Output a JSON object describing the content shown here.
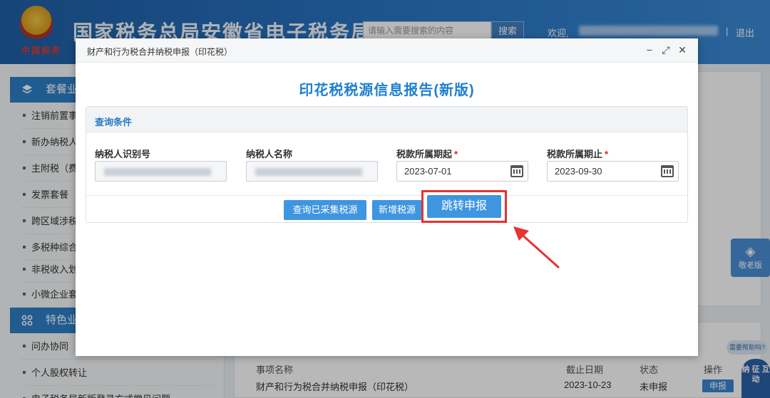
{
  "site": {
    "brand_tag": "中国税务",
    "title": "国家税务总局安徽省电子税务局",
    "search_placeholder": "请输入需要搜索的内容",
    "search_button": "搜索",
    "welcome": "欢迎,",
    "separator": "|",
    "logout": "退出"
  },
  "sidebar": {
    "sections": [
      {
        "label": "套餐业",
        "icon": "layers-icon"
      },
      {
        "label": "特色业",
        "icon": "grid-icon"
      }
    ],
    "items_a": [
      "注销前置事",
      "新办纳税人",
      "主附税（费",
      "发票套餐",
      "跨区域涉税",
      "多税种综合",
      "非税收入划",
      "小微企业套"
    ],
    "items_b": [
      "问办协同",
      "个人股权转让",
      "电子税务局新版登录方式常见问题"
    ]
  },
  "task_table": {
    "headers": [
      "事项名称",
      "截止日期",
      "状态",
      "操作"
    ],
    "row": {
      "name": "财产和行为税合并纳税申报（印花税）",
      "deadline": "2023-10-23",
      "status": "未申报",
      "action": "申报"
    }
  },
  "side_widgets": {
    "elder_mode": "敬老版",
    "help": "需要帮助吗?",
    "assistant": "纳 征 互 动"
  },
  "modal": {
    "title": "财产和行为税合并纳税申报（印花税）",
    "controls": {
      "minimize": "−",
      "maximize": "⤢",
      "close": "✕"
    },
    "report_title": "印花税税源信息报告(新版)",
    "query": {
      "section_label": "查询条件",
      "fields": [
        {
          "label": "纳税人识别号",
          "required": false,
          "value": ""
        },
        {
          "label": "纳税人名称",
          "required": false,
          "value": ""
        },
        {
          "label": "税款所属期起",
          "required": true,
          "value": "2023-07-01"
        },
        {
          "label": "税款所属期止",
          "required": true,
          "value": "2023-09-30"
        }
      ],
      "required_mark": "*",
      "buttons": {
        "query_collected": "查询已采集税源",
        "add_source": "新增税源",
        "jump_declare": "跳转申报"
      }
    }
  },
  "colors": {
    "accent": "#3e95e0",
    "title_blue": "#1e7fd0",
    "highlight_red": "#e63232"
  }
}
